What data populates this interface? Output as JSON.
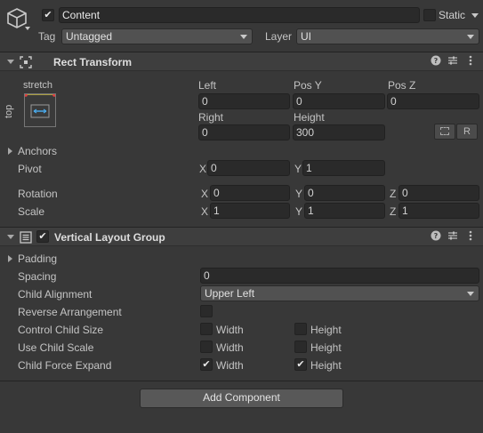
{
  "header": {
    "active": true,
    "name": "Content",
    "static_label": "Static",
    "static_checked": false,
    "tag_label": "Tag",
    "tag_value": "Untagged",
    "layer_label": "Layer",
    "layer_value": "UI"
  },
  "rect_transform": {
    "title": "Rect Transform",
    "anchor_preset_h": "stretch",
    "anchor_preset_v": "top",
    "labels": {
      "left": "Left",
      "pos_y": "Pos Y",
      "pos_z": "Pos Z",
      "right": "Right",
      "height": "Height"
    },
    "values": {
      "left": "0",
      "pos_y": "0",
      "pos_z": "0",
      "right": "0",
      "height": "300"
    },
    "raw_button": "R",
    "anchors_label": "Anchors",
    "pivot": {
      "label": "Pivot",
      "x_label": "X",
      "x": "0",
      "y_label": "Y",
      "y": "1"
    },
    "rotation": {
      "label": "Rotation",
      "x_label": "X",
      "x": "0",
      "y_label": "Y",
      "y": "0",
      "z_label": "Z",
      "z": "0"
    },
    "scale": {
      "label": "Scale",
      "x_label": "X",
      "x": "1",
      "y_label": "Y",
      "y": "1",
      "z_label": "Z",
      "z": "1"
    }
  },
  "vertical_layout_group": {
    "title": "Vertical Layout Group",
    "enabled": true,
    "padding_label": "Padding",
    "spacing": {
      "label": "Spacing",
      "value": "0"
    },
    "child_alignment": {
      "label": "Child Alignment",
      "value": "Upper Left"
    },
    "reverse_arrangement": {
      "label": "Reverse Arrangement",
      "checked": false
    },
    "control_child_size": {
      "label": "Control Child Size",
      "width_label": "Width",
      "width": false,
      "height_label": "Height",
      "height": false
    },
    "use_child_scale": {
      "label": "Use Child Scale",
      "width_label": "Width",
      "width": false,
      "height_label": "Height",
      "height": false
    },
    "child_force_expand": {
      "label": "Child Force Expand",
      "width_label": "Width",
      "width": true,
      "height_label": "Height",
      "height": true
    }
  },
  "add_component_label": "Add Component",
  "colors": {
    "background": "#383838",
    "header": "#3e3e3e",
    "field": "#2a2a2a",
    "text": "#c4c4c4"
  }
}
